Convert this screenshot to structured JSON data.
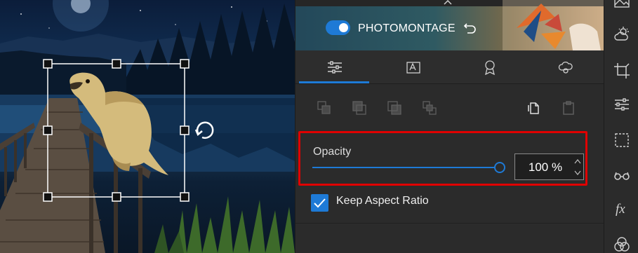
{
  "banner": {
    "label": "PHOTOMONTAGE",
    "toggle_on": true
  },
  "tabs": [
    {
      "icon": "sliders-icon",
      "active": true
    },
    {
      "icon": "text-box-icon",
      "active": false
    },
    {
      "icon": "badge-icon",
      "active": false
    },
    {
      "icon": "layers-cloud-icon",
      "active": false
    }
  ],
  "opacity": {
    "label": "Opacity",
    "value": "100 %",
    "level": 1.0
  },
  "aspect": {
    "label": "Keep Aspect Ratio",
    "checked": true
  },
  "colors": {
    "accent": "#1e7ad6",
    "highlight": "#e00000",
    "panel": "#2b2b2b"
  },
  "toolbar_icons": [
    "image-icon",
    "weather-icon",
    "crop-icon",
    "adjust-icon",
    "selection-icon",
    "glasses-icon",
    "fx-icon",
    "color-circles-icon"
  ],
  "toolbar_fx_label": "fx"
}
